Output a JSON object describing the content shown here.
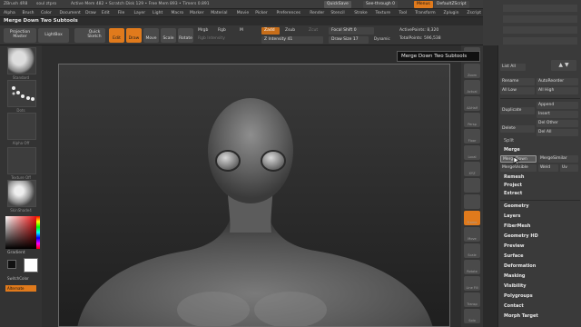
{
  "titlebar": {
    "app": "ZBrush 4R8",
    "doc": "soul ztpro",
    "stats": "Active Mem 482 • Scratch Disk 129 • Free Mem 893 • Timers 0.891",
    "quicksave": "QuickSave",
    "seethrough": "See-through 0",
    "menus_btn": "Menus",
    "zscript": "DefaultZScript"
  },
  "menubar": {
    "items": [
      "Alpha",
      "Brush",
      "Color",
      "Document",
      "Draw",
      "Edit",
      "File",
      "Layer",
      "Light",
      "Macro",
      "Marker",
      "Material",
      "Movie",
      "Picker",
      "Preferences",
      "Render",
      "Stencil",
      "Stroke",
      "Texture",
      "Tool",
      "Transform",
      "Zplugin",
      "Zscript"
    ]
  },
  "active_label": "Merge Down Two Subtools",
  "shelf": {
    "projection_master": "Projection Master",
    "lightbox": "LightBox",
    "quick_sketch": "Quick Sketch",
    "edit": "Edit",
    "draw": "Draw",
    "move": "Move",
    "scale": "Scale",
    "rotate": "Rotate",
    "mrgb": "Mrgb",
    "rgb": "Rgb",
    "m": "M",
    "rgb_intensity": "Rgb Intensity",
    "zadd": "Zadd",
    "zsub": "Zsub",
    "zcut": "Zcut",
    "z_intensity": "Z Intensity 41",
    "focal_shift": "Focal Shift 0",
    "draw_size": "Draw Size 17",
    "dynamic": "Dynamic",
    "active_points": "ActivePoints: 8,320",
    "total_points": "TotalPoints: 596,538"
  },
  "left_shelf": {
    "tiles": [
      "Standard",
      "Dots",
      "Alpha Off",
      "Texture Off",
      "SkinShade4"
    ],
    "gradient": "Gradient",
    "switch_color": "SwitchColor",
    "alternate": "Alternate"
  },
  "right_icons": [
    "Scroll",
    "Zoom",
    "Actual",
    "AAHalf",
    "Persp",
    "Floor",
    "Local",
    "XYZ",
    "",
    "",
    "Frame",
    "Move",
    "Scale",
    "Rotate",
    "Line Fill",
    "Transp",
    "Solo"
  ],
  "tooltip": "Merge Down Two Subtools",
  "subtool": {
    "list_all": "List All",
    "rename": "Rename",
    "autoreorder": "AutoReorder",
    "all_low": "All Low",
    "all_high": "All High",
    "duplicate": "Duplicate",
    "append": "Append",
    "insert": "Insert",
    "delete": "Delete",
    "del_other": "Del Other",
    "del_all": "Del All",
    "split": "Split",
    "merge": "Merge",
    "merge_down": "MergeDown",
    "merge_similar": "MergeSimilar",
    "merge_visible": "MergeVisible",
    "weld": "Weld",
    "uv": "Uv",
    "remesh": "Remesh",
    "project": "Project",
    "extract": "Extract"
  },
  "tool_sections": [
    "Geometry",
    "Layers",
    "FiberMesh",
    "Geometry HD",
    "Preview",
    "Surface",
    "Deformation",
    "Masking",
    "Visibility",
    "Polygroups",
    "Contact",
    "Morph Target"
  ],
  "colors": {
    "accent": "#e07a1c",
    "panel": "#3a3a3a",
    "viewport": "#2e2e2e"
  }
}
